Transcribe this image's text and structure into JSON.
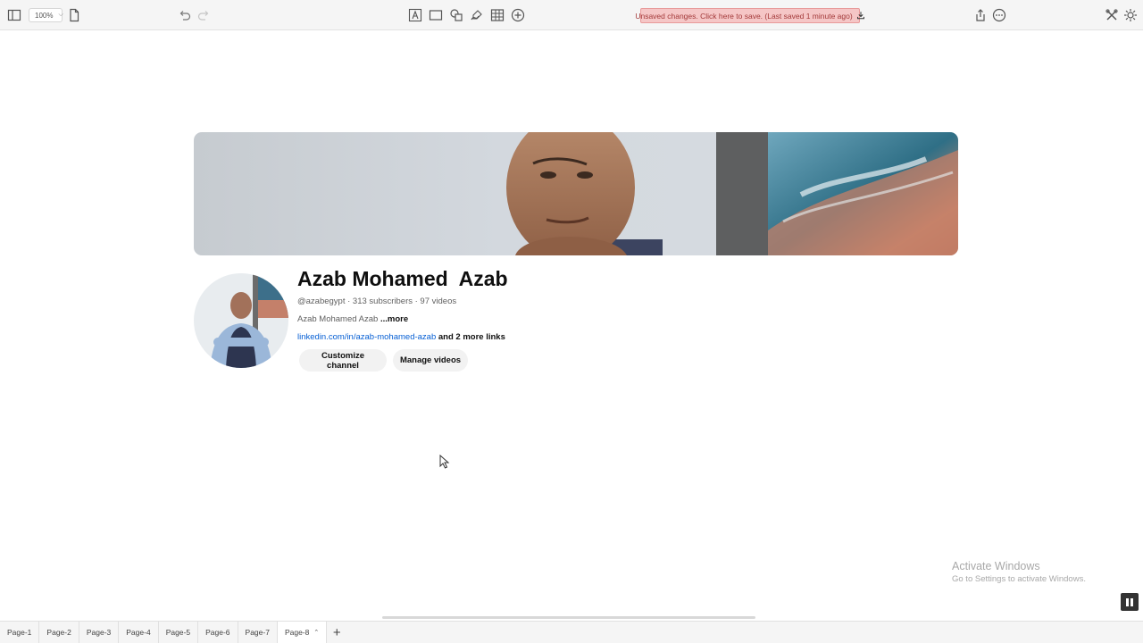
{
  "toolbar": {
    "zoom": "100%",
    "unsaved_notice": "Unsaved changes. Click here to save. (Last saved 1 minute ago)",
    "icons": [
      "sidebar-toggle-icon",
      "page-icon",
      "undo-icon",
      "redo-icon",
      "text-box-icon",
      "rectangle-icon",
      "shapes-icon",
      "pen-icon",
      "table-icon",
      "add-circle-icon",
      "download-icon",
      "share-icon",
      "more-icon",
      "tools-icon",
      "settings-icon"
    ]
  },
  "channel": {
    "name": "Azab Mohamed  Azab",
    "meta": "@azabegypt · 313 subscribers · 97 videos",
    "description": "Azab Mohamed Azab",
    "more": "...more",
    "link": "linkedin.com/in/azab-mohamed-azab",
    "more_links": "and 2 more links",
    "customize_label": "Customize channel",
    "manage_label": "Manage videos"
  },
  "watermark": {
    "title": "Activate Windows",
    "subtitle": "Go to Settings to activate Windows."
  },
  "page_tabs": [
    {
      "label": "Page-1",
      "active": false
    },
    {
      "label": "Page-2",
      "active": false
    },
    {
      "label": "Page-3",
      "active": false
    },
    {
      "label": "Page-4",
      "active": false
    },
    {
      "label": "Page-5",
      "active": false
    },
    {
      "label": "Page-6",
      "active": false
    },
    {
      "label": "Page-7",
      "active": false
    },
    {
      "label": "Page-8",
      "active": true
    }
  ],
  "colors": {
    "link": "#065fd4",
    "unsaved_bg": "#f5c6c6",
    "unsaved_text": "#a33a3a"
  }
}
